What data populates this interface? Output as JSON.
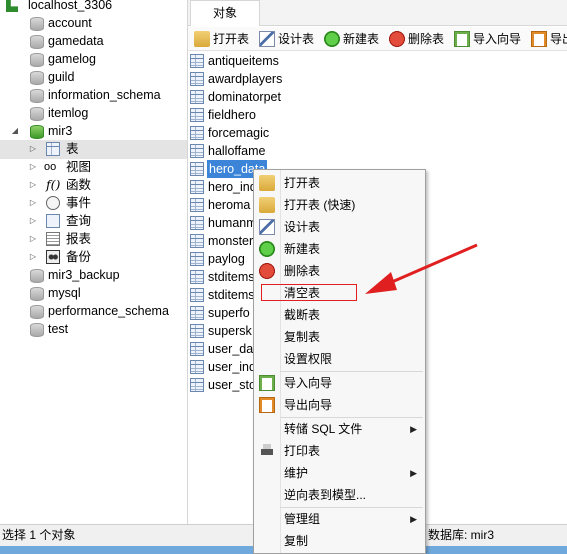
{
  "tree": {
    "connection": "localhost_3306",
    "databases_before": [
      "account",
      "gamedata",
      "gamelog",
      "guild",
      "information_schema",
      "itemlog"
    ],
    "open_db": "mir3",
    "open_db_children": [
      "表",
      "视图",
      "函数",
      "事件",
      "查询",
      "报表",
      "备份"
    ],
    "databases_after": [
      "mir3_backup",
      "mysql",
      "performance_schema",
      "test"
    ]
  },
  "tabs": {
    "objects_label": "对象"
  },
  "toolbar": {
    "open_table": "打开表",
    "design_table": "设计表",
    "new_table": "新建表",
    "delete_table": "删除表",
    "import_wizard": "导入向导",
    "export_wizard": "导出"
  },
  "objects": [
    "antiqueitems",
    "awardplayers",
    "dominatorpet",
    "fieldhero",
    "forcemagic",
    "halloffame",
    "hero_data",
    "hero_ind",
    "heroma",
    "humanm",
    "monster",
    "paylog",
    "stditems",
    "stditems",
    "superfo",
    "supersk",
    "user_day",
    "user_ind",
    "user_sto"
  ],
  "selected_object": "hero_data",
  "context_menu": {
    "open_table": "打开表",
    "open_table_fast": "打开表 (快速)",
    "design_table": "设计表",
    "new_table": "新建表",
    "delete_table": "删除表",
    "empty_table": "清空表",
    "truncate_table": "截断表",
    "copy_table": "复制表",
    "set_permissions": "设置权限",
    "import_wizard": "导入向导",
    "export_wizard": "导出向导",
    "dump_sql": "转储 SQL 文件",
    "print_table": "打印表",
    "maintain": "维护",
    "reverse_to_model": "逆向表到模型...",
    "manage_group": "管理组",
    "copy": "复制"
  },
  "status": {
    "left": "选择 1 个对象",
    "right": "数据库: mir3"
  },
  "colors": {
    "selection": "#3b84d8",
    "annotation": "#e02020"
  }
}
